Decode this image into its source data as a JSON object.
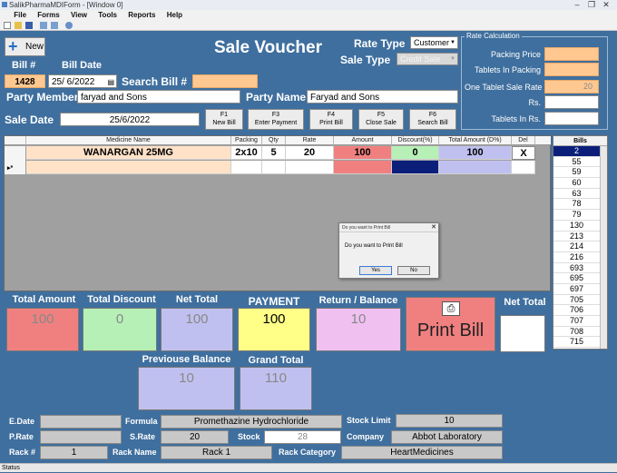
{
  "window": {
    "title": "SalikPharmaMDIForm - [Window 0]"
  },
  "menu": [
    "File",
    "Forms",
    "View",
    "Tools",
    "Reports",
    "Help"
  ],
  "header": {
    "new_label": "New",
    "title": "Sale Voucher",
    "rate_type_label": "Rate Type",
    "rate_type_value": "Customer",
    "sale_type_label": "Sale Type",
    "sale_type_value": "Credit Sale"
  },
  "bill": {
    "bill_no_label": "Bill #",
    "bill_no": "1428",
    "bill_date_label": "Bill Date",
    "bill_date": "25/ 6/2022",
    "search_label": "Search Bill #",
    "search_value": "",
    "party_member_label": "Party Member",
    "party_member": "faryad and Sons",
    "party_name_label": "Party Name",
    "party_name": "Faryad and Sons",
    "sale_date_label": "Sale Date",
    "sale_date": "25/6/2022"
  },
  "fkeys": [
    {
      "key": "F1",
      "label": "New Bill"
    },
    {
      "key": "F3",
      "label": "Enter Payment"
    },
    {
      "key": "F4",
      "label": "Print Bill"
    },
    {
      "key": "F5",
      "label": "Close Sale"
    },
    {
      "key": "F6",
      "label": "Search Bill"
    }
  ],
  "rate_calc": {
    "title": "Rate Calculation",
    "packing_price_label": "Packing Price",
    "packing_price": "",
    "tablets_in_packing_label": "Tablets In Packing",
    "tablets_in_packing": "",
    "one_tablet_rate_label": "One Tablet Sale Rate",
    "one_tablet_rate": "20",
    "rs_label": "Rs.",
    "rs_value": "",
    "tablets_in_rs_label": "Tablets In Rs.",
    "tablets_in_rs": ""
  },
  "grid": {
    "columns": [
      "Medicine Name",
      "Packing",
      "Qty",
      "Rate",
      "Amount",
      "Discount(%)",
      "Total Amount (D%)",
      "Del"
    ],
    "row": {
      "medicine": "WANARGAN 25MG",
      "packing": "2x10",
      "qty": "5",
      "rate": "20",
      "amount": "100",
      "discount": "0",
      "total": "100",
      "del": "X"
    },
    "new_row_marker": "▸*"
  },
  "bills": {
    "header": "Bills",
    "items": [
      "2",
      "55",
      "59",
      "60",
      "63",
      "78",
      "79",
      "130",
      "213",
      "214",
      "216",
      "693",
      "695",
      "697",
      "705",
      "706",
      "707",
      "708",
      "715"
    ]
  },
  "totals": {
    "total_amount_label": "Total Amount",
    "total_amount": "100",
    "total_discount_label": "Total Discount",
    "total_discount": "0",
    "net_total_label": "Net Total",
    "net_total": "100",
    "payment_label": "PAYMENT",
    "payment": "100",
    "return_label": "Return / Balance",
    "return_balance": "10",
    "print_bill_label": "Print Bill",
    "net_total2_label": "Net Total",
    "net_total2": "",
    "prev_balance_label": "Previouse Balance",
    "prev_balance": "10",
    "grand_total_label": "Grand Total",
    "grand_total": "110"
  },
  "dialog": {
    "title": "Do you want to Print Bill",
    "message": "Do you want to Print Bill",
    "yes": "Yes",
    "no": "No"
  },
  "info": {
    "edate_label": "E.Date",
    "edate": "",
    "formula_label": "Formula",
    "formula": "Promethazine Hydrochloride",
    "stock_limit_label": "Stock Limit",
    "stock_limit": "10",
    "prate_label": "P.Rate",
    "prate": "",
    "srate_label": "S.Rate",
    "srate": "20",
    "stock_label": "Stock",
    "stock": "28",
    "company_label": "Company",
    "company": "Abbot Laboratory",
    "rack_no_label": "Rack #",
    "rack_no": "1",
    "rack_name_label": "Rack Name",
    "rack_name": "Rack 1",
    "rack_cat_label": "Rack Category",
    "rack_cat": "HeartMedicines"
  },
  "status": "Status",
  "colors": {
    "background": "#3f6f9e",
    "orange": "#ffc891",
    "red": "#f08080",
    "green": "#b6f0b6",
    "lavender": "#c0c0f0",
    "yellow": "#ffff88",
    "pink": "#f0c0f0",
    "navy": "#0b1f7a"
  }
}
